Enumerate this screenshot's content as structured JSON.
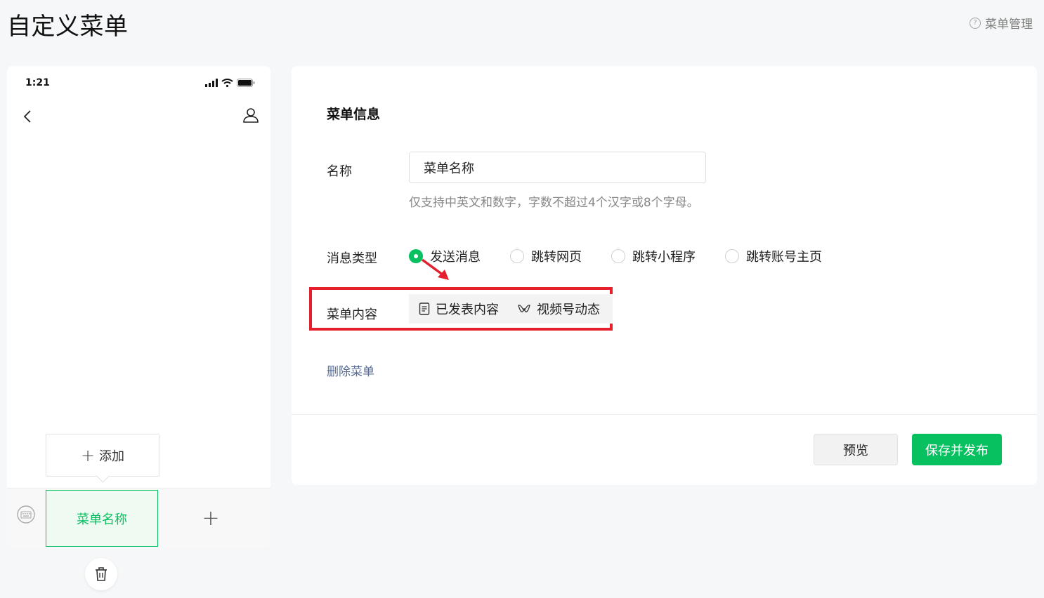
{
  "page": {
    "title": "自定义菜单",
    "help_label": "菜单管理"
  },
  "phone": {
    "time": "1:21",
    "add_label": "添加",
    "active_menu_label": "菜单名称"
  },
  "panel": {
    "section_title": "菜单信息",
    "name_label": "名称",
    "name_value": "菜单名称",
    "name_hint": "仅支持中英文和数字，字数不超过4个汉字或8个字母。",
    "message_type_label": "消息类型",
    "message_types": [
      {
        "label": "发送消息",
        "checked": true
      },
      {
        "label": "跳转网页",
        "checked": false
      },
      {
        "label": "跳转小程序",
        "checked": false
      },
      {
        "label": "跳转账号主页",
        "checked": false
      }
    ],
    "content_label": "菜单内容",
    "content_tabs": [
      {
        "label": "已发表内容",
        "icon": "document-icon"
      },
      {
        "label": "视频号动态",
        "icon": "channels-icon"
      }
    ],
    "delete_link": "删除菜单",
    "preview_button": "预览",
    "publish_button": "保存并发布"
  },
  "colors": {
    "accent": "#07c160",
    "highlight": "#e5202e",
    "link": "#576b95"
  }
}
